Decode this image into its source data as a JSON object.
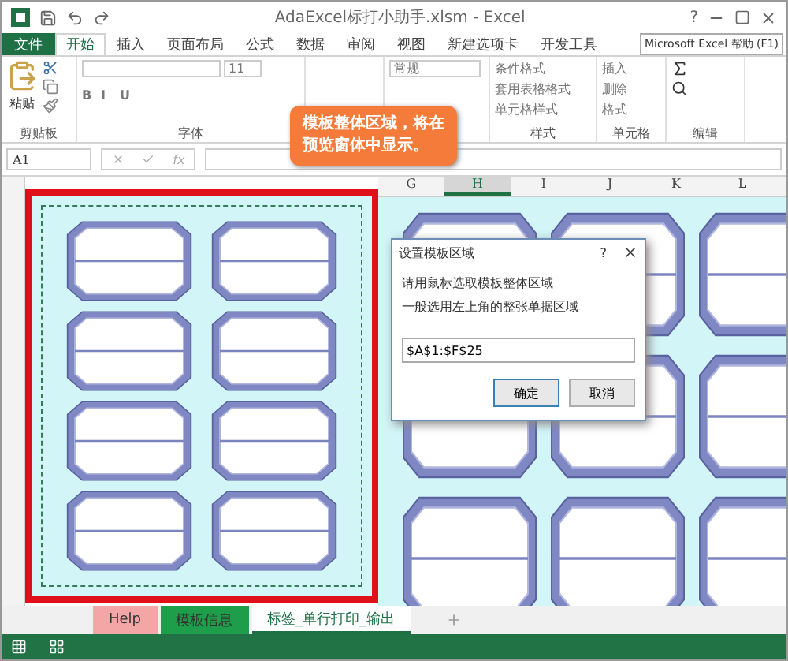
{
  "window": {
    "title": "AdaExcel标打小助手.xlsm - Excel",
    "help": "?"
  },
  "ribbon_tabs": [
    {
      "label": "文件",
      "selected": false,
      "kind": "file"
    },
    {
      "label": "开始",
      "selected": true,
      "kind": "tab"
    },
    {
      "label": "插入",
      "selected": false,
      "kind": "tab"
    },
    {
      "label": "页面布局",
      "selected": false,
      "kind": "tab"
    },
    {
      "label": "公式",
      "selected": false,
      "kind": "tab"
    },
    {
      "label": "数据",
      "selected": false,
      "kind": "tab"
    },
    {
      "label": "审阅",
      "selected": false,
      "kind": "tab"
    },
    {
      "label": "视图",
      "selected": false,
      "kind": "tab"
    },
    {
      "label": "新建选项卡",
      "selected": false,
      "kind": "tab"
    },
    {
      "label": "开发工具",
      "selected": false,
      "kind": "tab"
    }
  ],
  "help_box": "Microsoft Excel 帮助 (F1)",
  "ribbon": {
    "clipboard": {
      "label": "剪贴板",
      "paste": "粘贴"
    },
    "font": {
      "label": "字体",
      "size": "11",
      "buttons": [
        "B",
        "I",
        "U"
      ]
    },
    "number": {
      "format": "常规"
    },
    "styles": {
      "label": "样式",
      "items": [
        "条件格式",
        "套用表格格式",
        "单元格样式"
      ]
    },
    "cells": {
      "label": "单元格",
      "items": [
        "插入",
        "删除",
        "格式"
      ]
    },
    "editing": {
      "label": "编辑"
    }
  },
  "name_box": "A1",
  "fx_label": "fx",
  "callout": "模板整体区域，将在预览窗体中显示。",
  "columns": [
    {
      "label": "G",
      "selected": false
    },
    {
      "label": "H",
      "selected": true
    },
    {
      "label": "I",
      "selected": false
    },
    {
      "label": "J",
      "selected": false
    },
    {
      "label": "K",
      "selected": false
    },
    {
      "label": "L",
      "selected": false
    }
  ],
  "dialog": {
    "title": "设置模板区域",
    "help": "?",
    "lines": [
      "请用鼠标选取模板整体区域",
      "一般选用左上角的整张单据区域"
    ],
    "value": "$A$1:$F$25",
    "buttons": [
      {
        "label": "确定",
        "selected": true
      },
      {
        "label": "取消",
        "selected": false
      }
    ]
  },
  "sheet_tabs": [
    {
      "label": "Help",
      "color": "#f4a6a6",
      "selected": false
    },
    {
      "label": "模板信息",
      "color": "#1e9e4a",
      "selected": false
    },
    {
      "label": "标签_单行打印_输出",
      "color": "#ffffff",
      "selected": true
    }
  ]
}
